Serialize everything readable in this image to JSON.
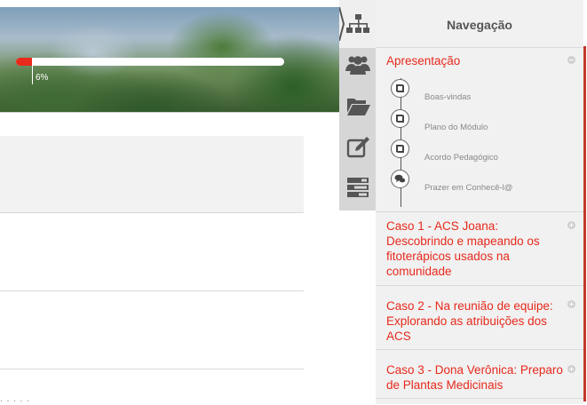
{
  "banner": {
    "progress_percent": 6,
    "progress_label": "6%"
  },
  "nav": {
    "title": "Navegação",
    "sections": [
      {
        "title": "Apresentação",
        "expanded": true,
        "items": [
          {
            "label": "Boas-vindas",
            "icon": "book-icon"
          },
          {
            "label": "Plano do Módulo",
            "icon": "book-icon"
          },
          {
            "label": "Acordo Pedagógico",
            "icon": "book-icon"
          },
          {
            "label": "Prazer em Conhecê-l@",
            "icon": "chat-icon"
          }
        ]
      },
      {
        "title_lines": [
          "Caso 1 - ACS Joana:",
          "Descobrindo e mapeando os",
          "fitoterápicos usados na",
          "comunidade"
        ],
        "expanded": false
      },
      {
        "title_lines": [
          "Caso 2 - Na reunião de equipe:",
          "Explorando as atribuições dos",
          "ACS"
        ],
        "expanded": false
      },
      {
        "title_lines": [
          "Caso 3 - Dona Verônica: Preparo",
          "de Plantas Medicinais"
        ],
        "expanded": false
      }
    ]
  },
  "sidebar_icons": [
    "sitemap-icon",
    "users-icon",
    "folder-open-icon",
    "edit-icon",
    "tasks-icon"
  ],
  "content": {
    "footer_fragment": "·  ·  ·  ·  ·"
  },
  "colors": {
    "accent": "#e8291c",
    "nav_bg": "#f1f1f1",
    "icon_col_bg": "#d6d6d6"
  }
}
